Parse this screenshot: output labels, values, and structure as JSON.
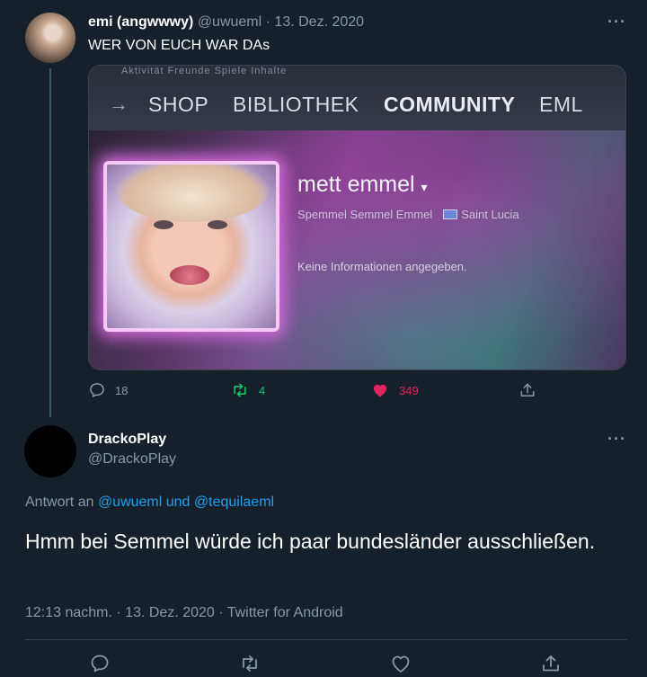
{
  "tweet1": {
    "display_name": "emi (angwwwy)",
    "handle": "@uwueml",
    "separator": "·",
    "date": "13. Dez. 2020",
    "text": "WER VON EUCH WAR DAs",
    "media": {
      "faint_nav": "Aktivität   Freunde   Spiele   Inhalte",
      "nav_arrow": "→",
      "nav_items": [
        "SHOP",
        "BIBLIOTHEK",
        "COMMUNITY",
        "EML"
      ],
      "profile_name": "mett emmel",
      "profile_name_caret": "▾",
      "profile_realname": "Spemmel Semmel Emmel",
      "profile_location": "Saint Lucia",
      "profile_info": "Keine Informationen angegeben."
    },
    "actions": {
      "reply_count": "18",
      "retweet_count": "4",
      "like_count": "349"
    }
  },
  "tweet2": {
    "display_name": "DrackoPlay",
    "handle": "@DrackoPlay",
    "reply_prefix": "Antwort an ",
    "reply_users": "@uwueml und @tequilaeml",
    "text": "Hmm bei Semmel würde ich paar bundesländer ausschließen.",
    "timestamp": "12:13 nachm. · 13. Dez. 2020 · Twitter for Android"
  },
  "more_label": "···",
  "colors": {
    "background": "#15202b",
    "secondary_text": "#8899a6",
    "link": "#1da1f2",
    "retweet_green": "#17bf63",
    "like_red": "#e0245e"
  },
  "icons": [
    "reply-icon",
    "retweet-icon",
    "like-icon",
    "share-icon",
    "more-icon"
  ]
}
